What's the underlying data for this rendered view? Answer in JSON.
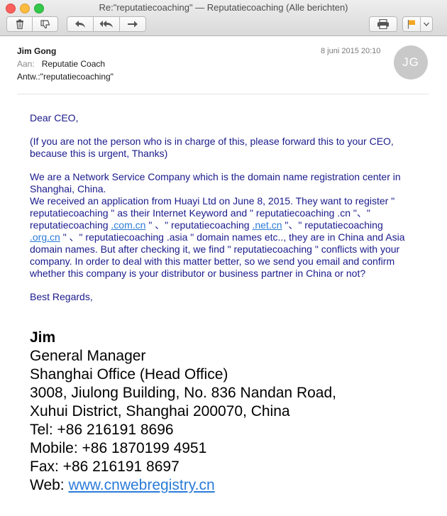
{
  "window": {
    "title": "Re:\"reputatiecoaching\" — Reputatiecoaching (Alle berichten)"
  },
  "toolbar": {
    "icons": [
      "trash-icon",
      "junk-thumbs-down-icon",
      "reply-icon",
      "reply-all-icon",
      "forward-icon",
      "print-icon",
      "flag-icon",
      "chevron-down-icon"
    ],
    "flag_color": "#f5a623"
  },
  "header": {
    "from": "Jim Gong",
    "date": "8 juni 2015 20:10",
    "avatar_initials": "JG",
    "to_label": "Aan:",
    "to_value": "Reputatie Coach",
    "reply_to": "Antw.:\"reputatiecoaching\""
  },
  "body": {
    "greeting": "Dear CEO,",
    "para1": "(If you are not the person who is in charge of this, please forward this to your CEO, because this is urgent, Thanks)",
    "para2_line1": "We are a Network Service Company which is the domain name registration center in Shanghai, China.",
    "para2_a": "We received an application from Huayi Ltd on June 8, 2015. They want to register \" reputatiecoaching \" as their Internet Keyword and \" reputatiecoaching .cn \"、\" reputatiecoaching ",
    "link_comcn": ".com.cn",
    "para2_b": " \" 、\" reputatiecoaching ",
    "link_netcn": ".net.cn",
    "para2_c": " \"、\" reputatiecoaching ",
    "link_orgcn": ".org.cn",
    "para2_d": " \" 、\" reputatiecoaching .asia \" domain names etc.., they are in China and Asia domain names. But after checking it, we find \" reputatiecoaching \" conflicts with your company. In order to deal with this matter better, so we send you email and confirm whether this company is your distributor or business partner in China or not?",
    "closing": "Best Regards,"
  },
  "signature": {
    "name": "Jim",
    "title": "General Manager",
    "office": "Shanghai Office (Head Office)",
    "address1": "3008, Jiulong Building, No. 836 Nandan Road,",
    "address2": "Xuhui District, Shanghai 200070, China",
    "tel": "Tel: +86 216191 8696",
    "mobile": "Mobile: +86 1870199 4951",
    "fax": "Fax: +86 216191 8697",
    "web_label": "Web: ",
    "web_link": "www.cnwebregistry.cn"
  }
}
